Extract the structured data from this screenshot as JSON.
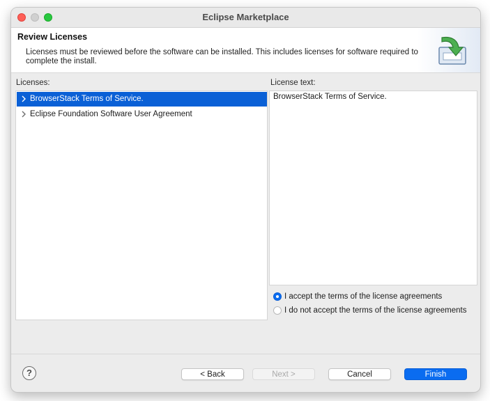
{
  "window": {
    "title": "Eclipse Marketplace"
  },
  "banner": {
    "title": "Review Licenses",
    "description": "Licenses must be reviewed before the software can be installed.  This includes licenses for software required to complete the install.",
    "icon": "install-download-icon"
  },
  "licenses": {
    "label": "Licenses:",
    "items": [
      {
        "label": "BrowserStack Terms of Service.",
        "selected": true,
        "icon": "chevron-right-icon"
      },
      {
        "label": "Eclipse Foundation Software User Agreement",
        "selected": false,
        "icon": "chevron-right-icon"
      }
    ]
  },
  "license_text": {
    "label": "License text:",
    "content": "BrowserStack Terms of Service."
  },
  "acceptance": {
    "options": [
      {
        "label": "I accept the terms of the license agreements",
        "checked": true
      },
      {
        "label": "I do not accept the terms of the license agreements",
        "checked": false
      }
    ]
  },
  "footer": {
    "help_label": "?",
    "back_label": "< Back",
    "next_label": "Next >",
    "cancel_label": "Cancel",
    "finish_label": "Finish"
  },
  "colors": {
    "accent": "#0a6cf0",
    "selection": "#0a60d6",
    "close": "#fe5f57",
    "maximize": "#29c840"
  }
}
